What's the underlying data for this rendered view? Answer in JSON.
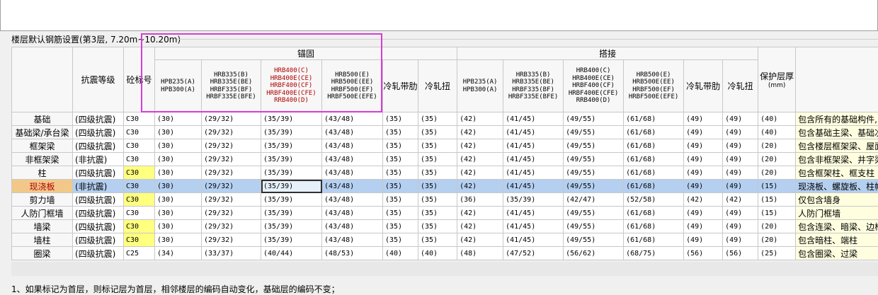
{
  "section_title": "楼层默认钢筋设置(第3层, 7.20m~10.20m)",
  "headers": {
    "name": "",
    "seismic": "抗震等级",
    "concrete": "砼标号",
    "anchor_group": "锚固",
    "lap_group": "搭接",
    "protection": "保护层厚",
    "protection_unit": "(mm)",
    "rebar_types": [
      "HPB235(A)\nHPB300(A)",
      "HRB335(B)\nHRB335E(BE)\nHRBF335(BF)\nHRBF335E(BFE)",
      "HRB400(C)\nHRB400E(CE)\nHRBF400(CF)\nHRBF400E(CFE)\nRRB400(D)",
      "HRB500(E)\nHRB500E(EE)\nHRBF500(EF)\nHRBF500E(EFE)",
      "冷轧带肋",
      "冷轧扭"
    ]
  },
  "rows": [
    {
      "name": "基础",
      "seismic": "(四级抗震)",
      "concrete": "C30",
      "anchor": [
        "(30)",
        "(29/32)",
        "(35/39)",
        "(43/48)",
        "(35)",
        "(35)"
      ],
      "lap": [
        "(42)",
        "(41/45)",
        "(49/55)",
        "(61/68)",
        "(49)",
        "(49)"
      ],
      "cover": "(40)",
      "desc": "包含所有的基础构件,"
    },
    {
      "name": "基础梁/承台梁",
      "seismic": "(四级抗震)",
      "concrete": "C30",
      "anchor": [
        "(30)",
        "(29/32)",
        "(35/39)",
        "(43/48)",
        "(35)",
        "(35)"
      ],
      "lap": [
        "(42)",
        "(41/45)",
        "(49/55)",
        "(61/68)",
        "(49)",
        "(49)"
      ],
      "cover": "(40)",
      "desc": "包含基础主梁、基础次"
    },
    {
      "name": "框架梁",
      "seismic": "(四级抗震)",
      "concrete": "C30",
      "anchor": [
        "(30)",
        "(29/32)",
        "(35/39)",
        "(43/48)",
        "(35)",
        "(35)"
      ],
      "lap": [
        "(42)",
        "(41/45)",
        "(49/55)",
        "(61/68)",
        "(49)",
        "(49)"
      ],
      "cover": "(20)",
      "desc": "包含楼层框架梁、屋面"
    },
    {
      "name": "非框架梁",
      "seismic": "(非抗震)",
      "concrete": "C30",
      "anchor": [
        "(30)",
        "(29/32)",
        "(35/39)",
        "(43/48)",
        "(35)",
        "(35)"
      ],
      "lap": [
        "(42)",
        "(41/45)",
        "(49/55)",
        "(61/68)",
        "(49)",
        "(49)"
      ],
      "cover": "(20)",
      "desc": "包含非框架梁、井字梁"
    },
    {
      "name": "柱",
      "seismic": "(四级抗震)",
      "concrete": "C30",
      "anchor": [
        "(30)",
        "(29/32)",
        "(35/39)",
        "(43/48)",
        "(35)",
        "(35)"
      ],
      "lap": [
        "(42)",
        "(41/45)",
        "(49/55)",
        "(61/68)",
        "(49)",
        "(49)"
      ],
      "cover": "(20)",
      "desc": "包含框架柱、框支柱"
    },
    {
      "name": "现浇板",
      "seismic": "(非抗震)",
      "concrete": "C30",
      "anchor": [
        "(30)",
        "(29/32)",
        "(35/39)",
        "(43/48)",
        "(35)",
        "(35)"
      ],
      "lap": [
        "(42)",
        "(41/45)",
        "(49/55)",
        "(61/68)",
        "(49)",
        "(49)"
      ],
      "cover": "(15)",
      "desc": "现浇板、螺旋板、柱帽"
    },
    {
      "name": "剪力墙",
      "seismic": "(四级抗震)",
      "concrete": "C30",
      "anchor": [
        "(30)",
        "(29/32)",
        "(35/39)",
        "(43/48)",
        "(35)",
        "(35)"
      ],
      "lap": [
        "(36)",
        "(35/39)",
        "(42/47)",
        "(52/58)",
        "(42)",
        "(42)"
      ],
      "cover": "(15)",
      "desc": "仅包含墙身"
    },
    {
      "name": "人防门框墙",
      "seismic": "(四级抗震)",
      "concrete": "C30",
      "anchor": [
        "(30)",
        "(29/32)",
        "(35/39)",
        "(43/48)",
        "(35)",
        "(35)"
      ],
      "lap": [
        "(42)",
        "(41/45)",
        "(49/55)",
        "(61/68)",
        "(49)",
        "(49)"
      ],
      "cover": "(15)",
      "desc": "人防门框墙"
    },
    {
      "name": "墙梁",
      "seismic": "(四级抗震)",
      "concrete": "C30",
      "anchor": [
        "(30)",
        "(29/32)",
        "(35/39)",
        "(43/48)",
        "(35)",
        "(35)"
      ],
      "lap": [
        "(42)",
        "(41/45)",
        "(49/55)",
        "(61/68)",
        "(49)",
        "(49)"
      ],
      "cover": "(20)",
      "desc": "包含连梁、暗梁、边框"
    },
    {
      "name": "墙柱",
      "seismic": "(四级抗震)",
      "concrete": "C30",
      "anchor": [
        "(30)",
        "(29/32)",
        "(35/39)",
        "(43/48)",
        "(35)",
        "(35)"
      ],
      "lap": [
        "(42)",
        "(41/45)",
        "(49/55)",
        "(61/68)",
        "(49)",
        "(49)"
      ],
      "cover": "(20)",
      "desc": "包含暗柱、端柱"
    },
    {
      "name": "圈梁",
      "seismic": "(四级抗震)",
      "concrete": "C25",
      "anchor": [
        "(34)",
        "(33/37)",
        "(40/44)",
        "(48/53)",
        "(40)",
        "(40)"
      ],
      "lap": [
        "(48)",
        "(47/52)",
        "(56/62)",
        "(68/75)",
        "(56)",
        "(56)"
      ],
      "cover": "(25)",
      "desc": "包含圈梁、过梁"
    }
  ],
  "footnote": "1、如果标记为首层，则标记层为首层，相邻楼层的编码自动变化，基础层的编码不变；",
  "colors": {
    "highlight_header": "#f7c272",
    "selected_row": "#b4cff0",
    "concrete_yellow": "#ffff80",
    "box": "#d63cd6"
  }
}
